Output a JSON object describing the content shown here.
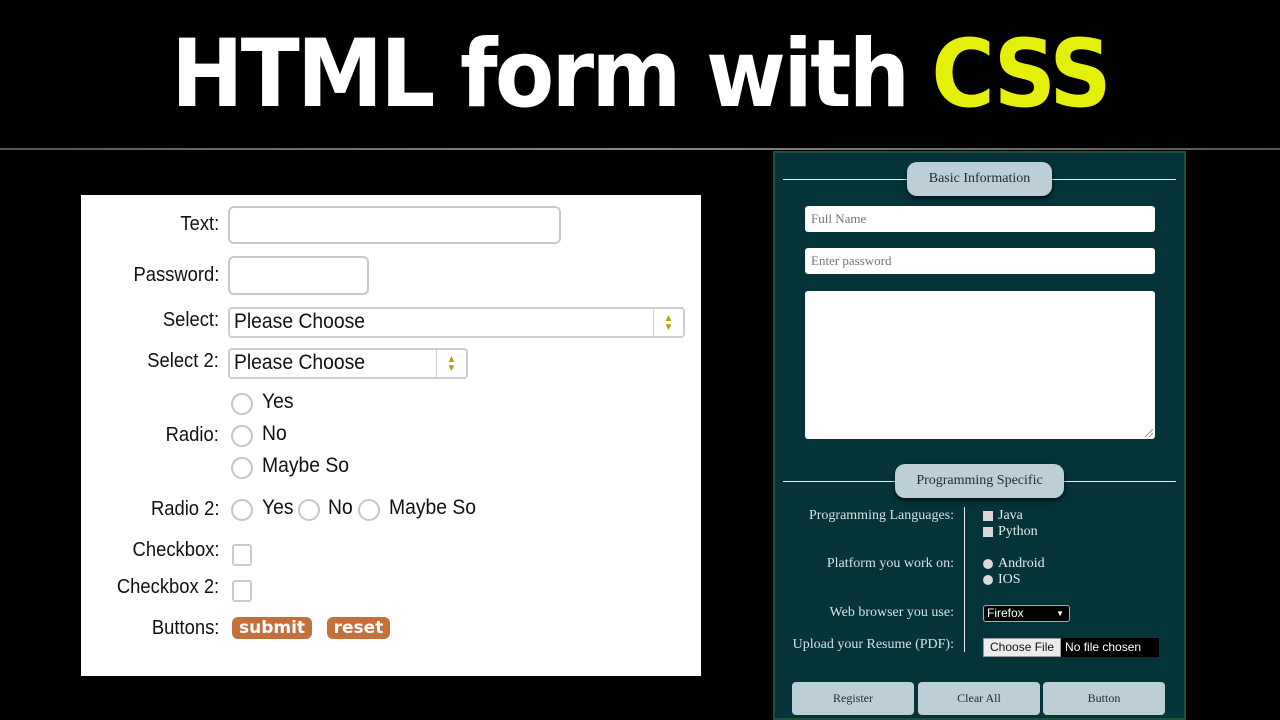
{
  "banner": {
    "title_main": "HTML form with",
    "title_accent": "CSS",
    "accent_color": "#e4f00a"
  },
  "left_form": {
    "text_label": "Text:",
    "text_value": "",
    "password_label": "Password:",
    "password_value": "",
    "select_label": "Select:",
    "select_value": "Please Choose",
    "select2_label": "Select 2:",
    "select2_value": "Please Choose",
    "radio_label": "Radio:",
    "radio_options": [
      "Yes",
      "No",
      "Maybe So"
    ],
    "radio2_label": "Radio 2:",
    "radio2_options": [
      "Yes",
      "No",
      "Maybe So"
    ],
    "checkbox_label": "Checkbox:",
    "checkbox2_label": "Checkbox 2:",
    "buttons_label": "Buttons:",
    "submit_label": "submit",
    "reset_label": "reset",
    "button_color": "#c4703a"
  },
  "right_form": {
    "section1_legend": "Basic Information",
    "fullname_placeholder": "Full Name",
    "password_placeholder": "Enter password",
    "textarea_value": "",
    "section2_legend": "Programming Specific",
    "languages_label": "Programming Languages:",
    "languages": [
      "Java",
      "Python"
    ],
    "platform_label": "Platform you work on:",
    "platforms": [
      "Android",
      "IOS"
    ],
    "browser_label": "Web browser you use:",
    "browser_value": "Firefox",
    "resume_label": "Upload your Resume (PDF):",
    "choose_file_label": "Choose File",
    "no_file_text": "No file chosen",
    "buttons": [
      "Register",
      "Clear All",
      "Button"
    ],
    "background_color": "#04333a"
  }
}
